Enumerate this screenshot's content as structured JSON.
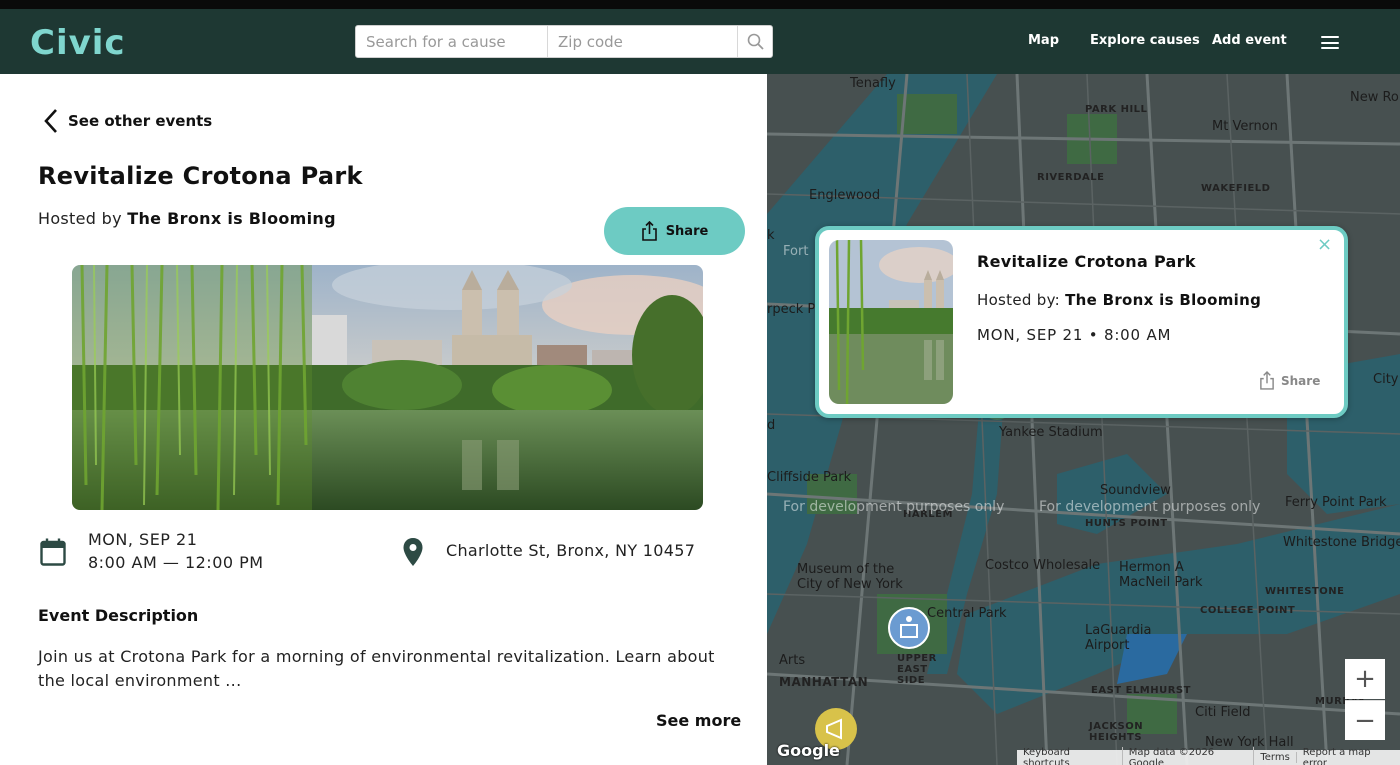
{
  "header": {
    "logo": "Civic",
    "search_cause_placeholder": "Search for a cause",
    "search_zip_placeholder": "Zip code",
    "nav": [
      "Map",
      "Explore causes",
      "Add event"
    ]
  },
  "event": {
    "back_label": "See other events",
    "title": "Revitalize Crotona Park",
    "hosted_prefix": "Hosted by",
    "host": "The Bronx is Blooming",
    "share_label": "Share",
    "date": "MON, SEP 21",
    "time": "8:00 AM — 12:00 PM",
    "address": "Charlotte St, Bronx, NY 10457",
    "description_heading": "Event Description",
    "description": "Join us at Crotona Park for a morning of environmental revitalization. Learn about the local environment ...",
    "see_more": "See more"
  },
  "popup": {
    "title": "Revitalize Crotona Park",
    "hosted_prefix": "Hosted by:",
    "host": "The Bronx is Blooming",
    "datetime": "MON, SEP 21 • 8:00 AM",
    "share_label": "Share",
    "close": "×"
  },
  "map": {
    "labels": [
      "Tenafly",
      "New Ro",
      "PARK HILL",
      "Mt Vernon",
      "RIVERDALE",
      "WAKEFIELD",
      "Englewood",
      "Yankee Stadium",
      "Cliffside Park",
      "Soundview",
      "HUNTS POINT",
      "Ferry Point Park",
      "Whitestone Bridge",
      "HARLEM",
      "Costco Wholesale",
      "Hermon A MacNeil Park",
      "WHITESTONE",
      "COLLEGE POINT",
      "Museum of the City of New York",
      "Central Park",
      "UPPER EAST SIDE",
      "LaGuardia Airport",
      "MANHATTAN",
      "EAST ELMHURST",
      "JACKSON HEIGHTS",
      "Citi Field",
      "New York Hall",
      "City Is",
      "rpeck Park",
      "Fort",
      "k",
      "d",
      "Arts",
      "MURRAY"
    ],
    "dev_notice": "For development purposes only",
    "zoom_in": "+",
    "zoom_out": "−",
    "attribution": [
      "Keyboard shortcuts",
      "Map data ©2026 Google",
      "Terms",
      "Report a map error"
    ],
    "google_logo": "Google"
  },
  "colors": {
    "header_bg": "#1e3833",
    "accent": "#6dcbc3",
    "logo": "#7fd6ce"
  }
}
